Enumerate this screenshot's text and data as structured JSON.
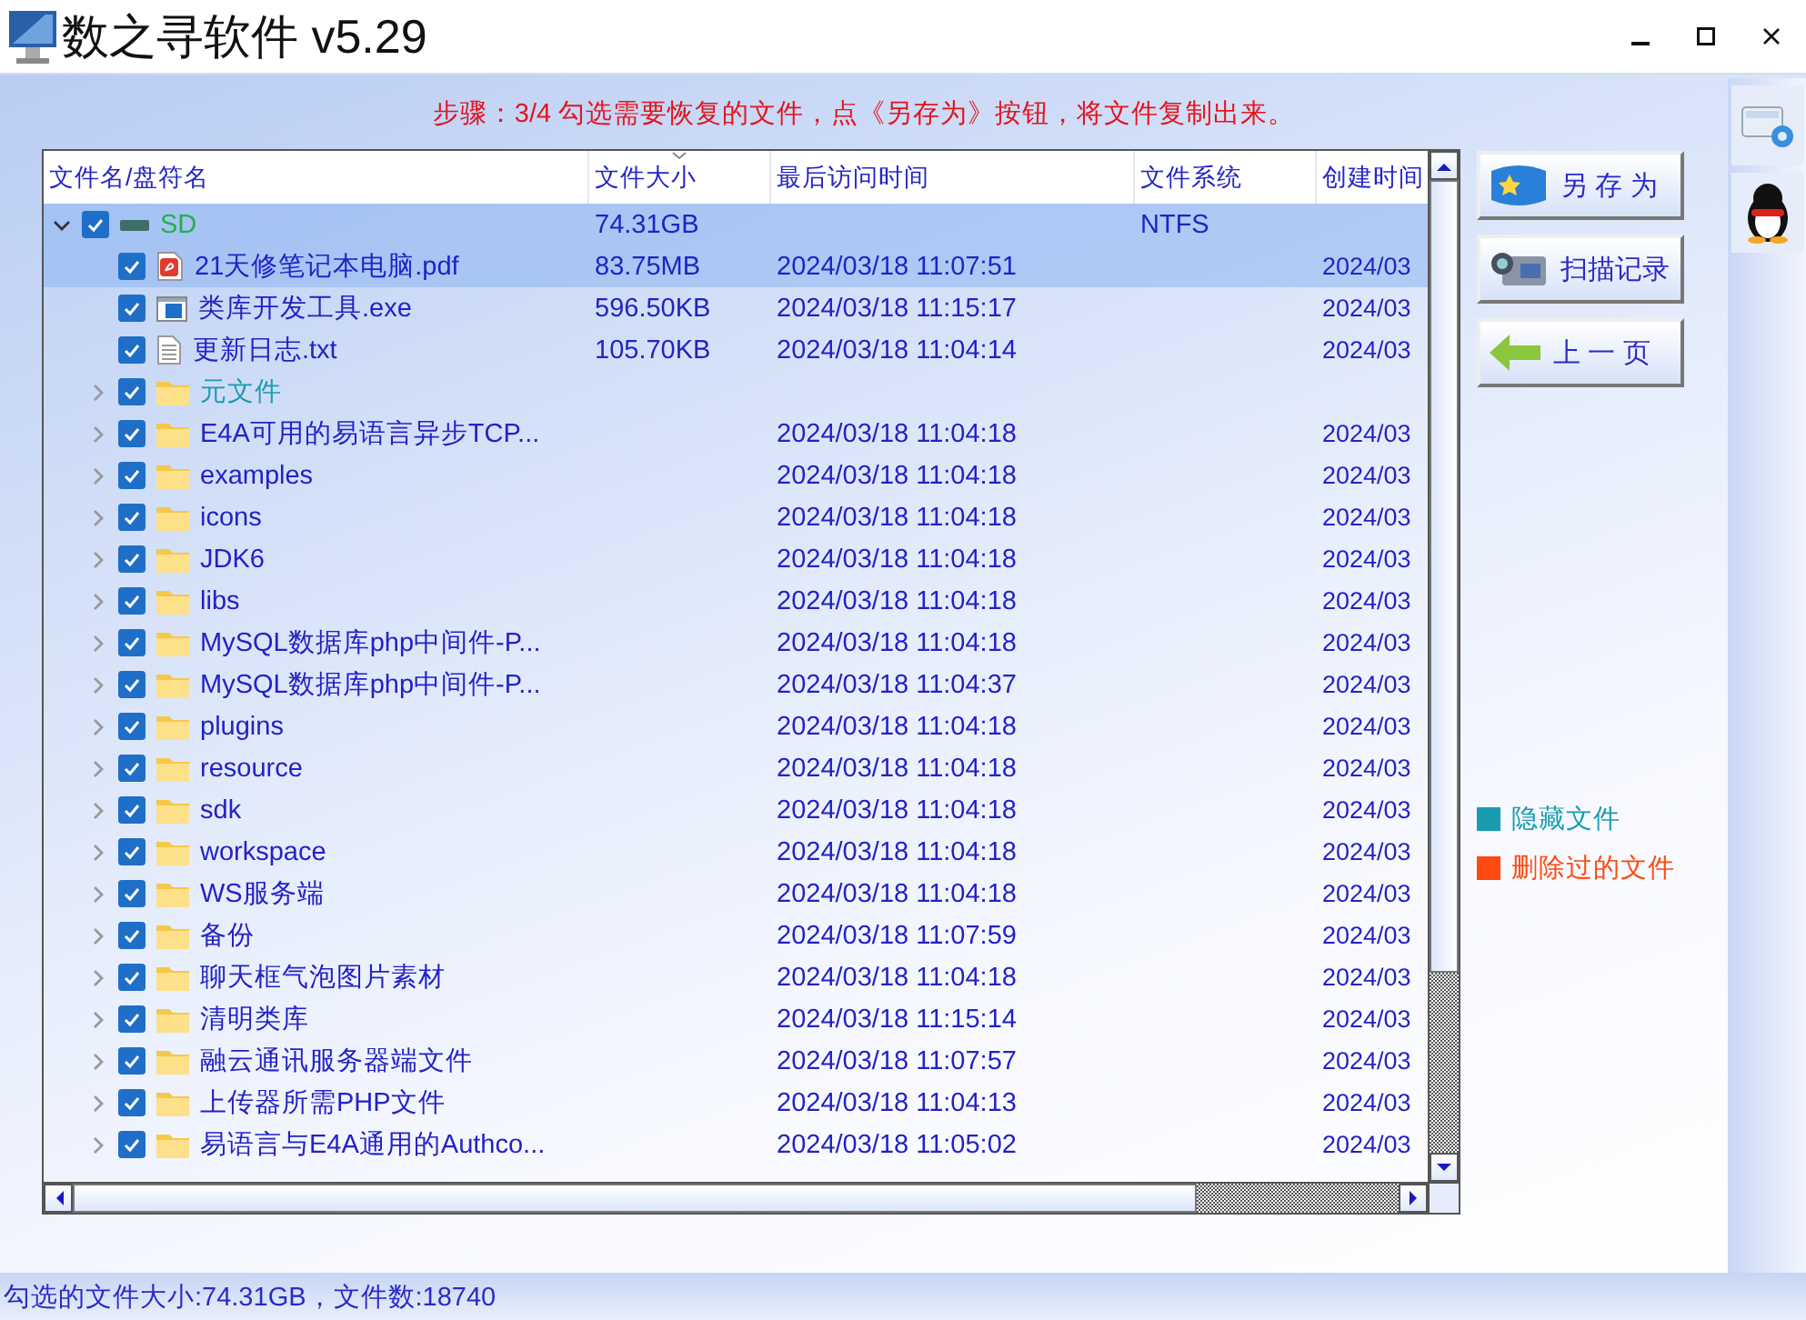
{
  "window": {
    "title": "数之寻软件 v5.29"
  },
  "step_hint": "步骤：3/4 勾选需要恢复的文件，点《另存为》按钮，将文件复制出来。",
  "file_table": {
    "columns": [
      {
        "label": "文件名/盘符名",
        "sorted": false
      },
      {
        "label": "文件大小",
        "sorted": true
      },
      {
        "label": "最后访问时间",
        "sorted": false
      },
      {
        "label": "文件系统",
        "sorted": false
      },
      {
        "label": "创建时间",
        "sorted": false
      }
    ],
    "items": [
      {
        "kind": "drive",
        "name": "SD",
        "size": "74.31GB",
        "filesystem": "NTFS",
        "checked": true,
        "selected": true,
        "expanded": true,
        "children": [
          {
            "kind": "pdf",
            "name": "21天修笔记本电脑.pdf",
            "size": "83.75MB",
            "accessed": "2024/03/18 11:07:51",
            "created": "2024/03",
            "checked": true,
            "selected": true,
            "hidden": false
          },
          {
            "kind": "exe",
            "name": "类库开发工具.exe",
            "size": "596.50KB",
            "accessed": "2024/03/18 11:15:17",
            "created": "2024/03",
            "checked": true,
            "selected": false,
            "hidden": false
          },
          {
            "kind": "txt",
            "name": "更新日志.txt",
            "size": "105.70KB",
            "accessed": "2024/03/18 11:04:14",
            "created": "2024/03",
            "checked": true,
            "selected": false,
            "hidden": false
          },
          {
            "kind": "folder",
            "name": "元文件",
            "checked": true,
            "selected": false,
            "hidden": true,
            "expanded": false
          },
          {
            "kind": "folder",
            "name": "E4A可用的易语言异步TCP...",
            "accessed": "2024/03/18 11:04:18",
            "created": "2024/03",
            "checked": true,
            "selected": false,
            "hidden": false,
            "expanded": false
          },
          {
            "kind": "folder",
            "name": "examples",
            "accessed": "2024/03/18 11:04:18",
            "created": "2024/03",
            "checked": true,
            "selected": false,
            "hidden": false,
            "expanded": false
          },
          {
            "kind": "folder",
            "name": "icons",
            "accessed": "2024/03/18 11:04:18",
            "created": "2024/03",
            "checked": true,
            "selected": false,
            "hidden": false,
            "expanded": false
          },
          {
            "kind": "folder",
            "name": "JDK6",
            "accessed": "2024/03/18 11:04:18",
            "created": "2024/03",
            "checked": true,
            "selected": false,
            "hidden": false,
            "expanded": false
          },
          {
            "kind": "folder",
            "name": "libs",
            "accessed": "2024/03/18 11:04:18",
            "created": "2024/03",
            "checked": true,
            "selected": false,
            "hidden": false,
            "expanded": false
          },
          {
            "kind": "folder",
            "name": "MySQL数据库php中间件-P...",
            "accessed": "2024/03/18 11:04:18",
            "created": "2024/03",
            "checked": true,
            "selected": false,
            "hidden": false,
            "expanded": false
          },
          {
            "kind": "folder",
            "name": "MySQL数据库php中间件-P...",
            "accessed": "2024/03/18 11:04:37",
            "created": "2024/03",
            "checked": true,
            "selected": false,
            "hidden": false,
            "expanded": false
          },
          {
            "kind": "folder",
            "name": "plugins",
            "accessed": "2024/03/18 11:04:18",
            "created": "2024/03",
            "checked": true,
            "selected": false,
            "hidden": false,
            "expanded": false
          },
          {
            "kind": "folder",
            "name": "resource",
            "accessed": "2024/03/18 11:04:18",
            "created": "2024/03",
            "checked": true,
            "selected": false,
            "hidden": false,
            "expanded": false
          },
          {
            "kind": "folder",
            "name": "sdk",
            "accessed": "2024/03/18 11:04:18",
            "created": "2024/03",
            "checked": true,
            "selected": false,
            "hidden": false,
            "expanded": false
          },
          {
            "kind": "folder",
            "name": "workspace",
            "accessed": "2024/03/18 11:04:18",
            "created": "2024/03",
            "checked": true,
            "selected": false,
            "hidden": false,
            "expanded": false
          },
          {
            "kind": "folder",
            "name": "WS服务端",
            "accessed": "2024/03/18 11:04:18",
            "created": "2024/03",
            "checked": true,
            "selected": false,
            "hidden": false,
            "expanded": false
          },
          {
            "kind": "folder",
            "name": "备份",
            "accessed": "2024/03/18 11:07:59",
            "created": "2024/03",
            "checked": true,
            "selected": false,
            "hidden": false,
            "expanded": false
          },
          {
            "kind": "folder",
            "name": "聊天框气泡图片素材",
            "accessed": "2024/03/18 11:04:18",
            "created": "2024/03",
            "checked": true,
            "selected": false,
            "hidden": false,
            "expanded": false
          },
          {
            "kind": "folder",
            "name": "清明类库",
            "accessed": "2024/03/18 11:15:14",
            "created": "2024/03",
            "checked": true,
            "selected": false,
            "hidden": false,
            "expanded": false
          },
          {
            "kind": "folder",
            "name": "融云通讯服务器端文件",
            "accessed": "2024/03/18 11:07:57",
            "created": "2024/03",
            "checked": true,
            "selected": false,
            "hidden": false,
            "expanded": false
          },
          {
            "kind": "folder",
            "name": "上传器所需PHP文件",
            "accessed": "2024/03/18 11:04:13",
            "created": "2024/03",
            "checked": true,
            "selected": false,
            "hidden": false,
            "expanded": false
          },
          {
            "kind": "folder",
            "name": "易语言与E4A通用的Authco...",
            "accessed": "2024/03/18 11:05:02",
            "created": "2024/03",
            "checked": true,
            "selected": false,
            "hidden": false,
            "expanded": false
          }
        ]
      }
    ]
  },
  "actions": [
    {
      "kind": "save",
      "label": "另 存 为"
    },
    {
      "kind": "scan",
      "label": "扫描记录"
    },
    {
      "kind": "back",
      "label": "上 一 页"
    }
  ],
  "legend": [
    {
      "label": "隐藏文件",
      "color": "#1a9cb0"
    },
    {
      "label": "删除过的文件",
      "color": "#ff4a10"
    }
  ],
  "status_bar": "勾选的文件大小:74.31GB，文件数:18740"
}
